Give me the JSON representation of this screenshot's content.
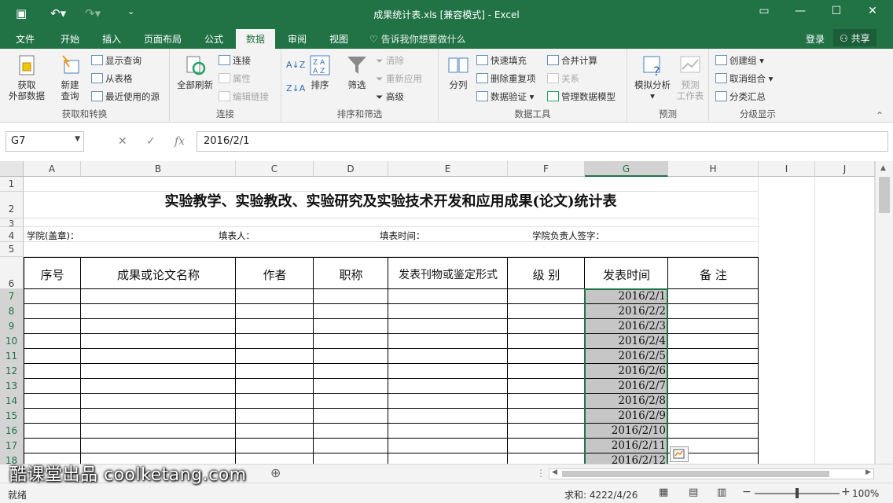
{
  "window": {
    "title": "成果统计表.xls  [兼容模式] - Excel",
    "buttons": {
      "restore": "▭",
      "minimize": "—",
      "maximize": "☐",
      "close": "✕"
    }
  },
  "tabs": [
    "文件",
    "开始",
    "插入",
    "页面布局",
    "公式",
    "数据",
    "审阅",
    "视图"
  ],
  "active_tab": "数据",
  "tell_me": "告诉我你想要做什么",
  "login": "登录",
  "share": "共享",
  "ribbon": {
    "get_transform": {
      "label": "获取和转换",
      "get_external": "获取\n外部数据",
      "new_query": "新建\n查询",
      "show_queries": "显示查询",
      "from_table": "从表格",
      "recent_sources": "最近使用的源"
    },
    "connections": {
      "label": "连接",
      "refresh_all": "全部刷新",
      "connect": "连接",
      "properties": "属性",
      "edit_links": "编辑链接"
    },
    "sort_filter": {
      "label": "排序和筛选",
      "sort": "排序",
      "filter": "筛选",
      "clear": "清除",
      "reapply": "重新应用",
      "advanced": "高级"
    },
    "data_tools": {
      "label": "数据工具",
      "split": "分列",
      "flash_fill": "快速填充",
      "remove_dup": "删除重复项",
      "validation": "数据验证",
      "consolidate": "合并计算",
      "relations": "关系",
      "manage_model": "管理数据模型"
    },
    "forecast": {
      "label": "预测",
      "what_if": "模拟分析",
      "forecast_sheet": "预测\n工作表"
    },
    "outline": {
      "label": "分级显示",
      "group": "创建组",
      "ungroup": "取消组合",
      "subtotal": "分类汇总"
    }
  },
  "formula_bar": {
    "name_box": "G7",
    "cancel": "✕",
    "enter": "✓",
    "fx": "fx",
    "value": "2016/2/1"
  },
  "columns": [
    "A",
    "B",
    "C",
    "D",
    "E",
    "F",
    "G",
    "H",
    "I",
    "J"
  ],
  "rows": [
    "1",
    "2",
    "3",
    "4",
    "5",
    "6",
    "7",
    "8",
    "9",
    "10",
    "11",
    "12",
    "13",
    "14",
    "15",
    "16",
    "17",
    "18"
  ],
  "sheet": {
    "title": "实验教学、实验教改、实验研究及实验技术开发和应用成果(论文)统计表",
    "info": [
      "学院(盖章)：",
      "填表人：",
      "填表时间：",
      "学院负责人签字："
    ],
    "headers": [
      "序号",
      "成果或论文名称",
      "作者",
      "职称",
      "发表刊物或鉴定形式",
      "级 别",
      "发表时间",
      "备 注"
    ],
    "dates": [
      "2016/2/1",
      "2016/2/2",
      "2016/2/3",
      "2016/2/4",
      "2016/2/5",
      "2016/2/6",
      "2016/2/7",
      "2016/2/8",
      "2016/2/9",
      "2016/2/10",
      "2016/2/11",
      "2016/2/12"
    ]
  },
  "status": {
    "ready": "就绪",
    "sum": "求和: 4222/4/26",
    "zoom": "100%"
  },
  "watermark": "酷课堂出品 coolketang.com"
}
